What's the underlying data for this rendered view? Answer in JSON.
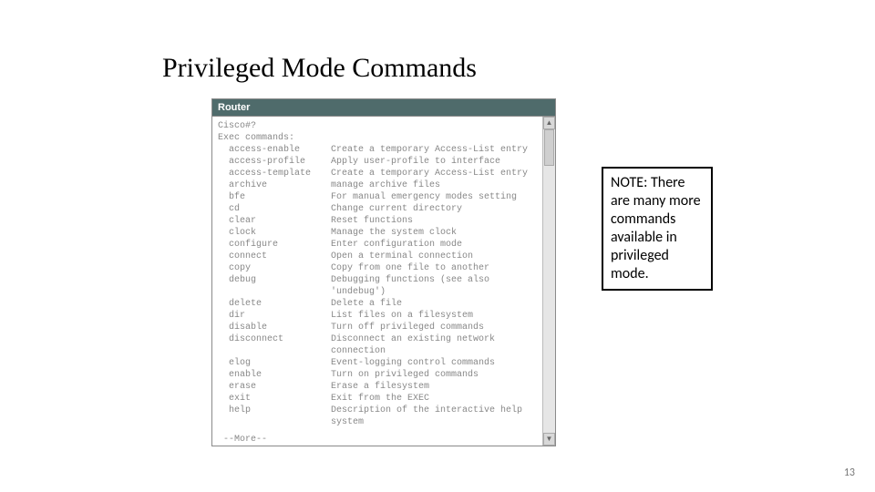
{
  "title": "Privileged Mode Commands",
  "router": {
    "title": "Router",
    "prompt": "Cisco#?",
    "header": "Exec commands:",
    "commands": [
      {
        "cmd": "access-enable",
        "desc": "Create a temporary Access-List entry"
      },
      {
        "cmd": "access-profile",
        "desc": "Apply user-profile to interface"
      },
      {
        "cmd": "access-template",
        "desc": "Create a temporary Access-List entry"
      },
      {
        "cmd": "archive",
        "desc": "manage archive files"
      },
      {
        "cmd": "bfe",
        "desc": "For manual emergency modes setting"
      },
      {
        "cmd": "cd",
        "desc": "Change current directory"
      },
      {
        "cmd": "clear",
        "desc": "Reset functions"
      },
      {
        "cmd": "clock",
        "desc": "Manage the system clock"
      },
      {
        "cmd": "configure",
        "desc": "Enter configuration mode"
      },
      {
        "cmd": "connect",
        "desc": "Open a terminal connection"
      },
      {
        "cmd": "copy",
        "desc": "Copy from one file to another"
      },
      {
        "cmd": "debug",
        "desc": "Debugging functions (see also 'undebug')"
      },
      {
        "cmd": "delete",
        "desc": "Delete a file"
      },
      {
        "cmd": "dir",
        "desc": "List files on a filesystem"
      },
      {
        "cmd": "disable",
        "desc": "Turn off privileged commands"
      },
      {
        "cmd": "disconnect",
        "desc": "Disconnect an existing network connection"
      },
      {
        "cmd": "elog",
        "desc": "Event-logging control commands"
      },
      {
        "cmd": "enable",
        "desc": "Turn on privileged commands"
      },
      {
        "cmd": "erase",
        "desc": "Erase a filesystem"
      },
      {
        "cmd": "exit",
        "desc": "Exit from the EXEC"
      },
      {
        "cmd": "help",
        "desc": "Description of the interactive help system"
      }
    ],
    "more": "--More--"
  },
  "note": "NOTE: There are many more commands available in privileged mode.",
  "page": "13"
}
